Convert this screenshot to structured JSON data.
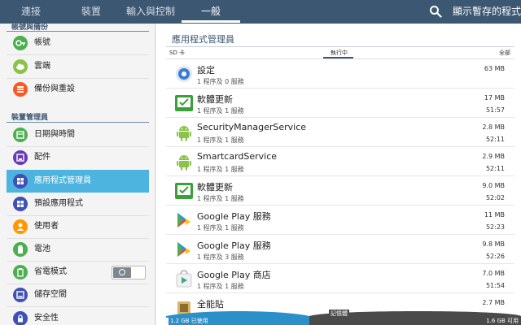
{
  "tabs": [
    {
      "label": "連接"
    },
    {
      "label": "裝置"
    },
    {
      "label": "輸入與控制"
    },
    {
      "label": "一般"
    }
  ],
  "topbar": {
    "action_label": "顯示暫存的程式"
  },
  "sidebar": {
    "section_top": "帳號與備份",
    "items_top": [
      {
        "label": "帳號",
        "icon": "account-icon",
        "color": "#4caf50"
      },
      {
        "label": "雲端",
        "icon": "cloud-icon",
        "color": "#8bc34a"
      },
      {
        "label": "備份與重設",
        "icon": "backup-icon",
        "color": "#ff5722"
      }
    ],
    "section_device": "裝置管理員",
    "items_device": [
      {
        "label": "日期與時間",
        "icon": "calendar-icon",
        "color": "#4caf50"
      },
      {
        "label": "配件",
        "icon": "accessory-icon",
        "color": "#673ab7"
      },
      {
        "label": "應用程式管理員",
        "icon": "apps-icon",
        "color": "#3f51b5",
        "active": true
      },
      {
        "label": "預設應用程式",
        "icon": "default-apps-icon",
        "color": "#3f51b5"
      },
      {
        "label": "使用者",
        "icon": "users-icon",
        "color": "#ff9800"
      },
      {
        "label": "電池",
        "icon": "battery-icon",
        "color": "#4caf50"
      },
      {
        "label": "省電模式",
        "icon": "power-saving-icon",
        "color": "#4caf50"
      },
      {
        "label": "儲存空間",
        "icon": "storage-icon",
        "color": "#3f51b5"
      },
      {
        "label": "安全性",
        "icon": "security-icon",
        "color": "#3f51b5"
      }
    ]
  },
  "main": {
    "title": "應用程式管理員",
    "subtabs": [
      "SD 卡",
      "執行中",
      "全部"
    ],
    "apps": [
      {
        "name": "設定",
        "sub": "1 程序及 0 服務",
        "size": "63 MB",
        "time": "",
        "icon": "settings-icon"
      },
      {
        "name": "軟體更新",
        "sub": "1 程序及 1 服務",
        "size": "17 MB",
        "time": "51:57",
        "icon": "software-update-icon"
      },
      {
        "name": "SecurityManagerService",
        "sub": "1 程序及 1 服務",
        "size": "2.8 MB",
        "time": "52:11",
        "icon": "android-icon"
      },
      {
        "name": "SmartcardService",
        "sub": "1 程序及 1 服務",
        "size": "2.9 MB",
        "time": "52:11",
        "icon": "android-icon"
      },
      {
        "name": "軟體更新",
        "sub": "1 程序及 1 服務",
        "size": "9.0 MB",
        "time": "52:02",
        "icon": "software-update-icon"
      },
      {
        "name": "Google Play 服務",
        "sub": "1 程序及 1 服務",
        "size": "11 MB",
        "time": "52:23",
        "icon": "google-play-services-icon"
      },
      {
        "name": "Google Play 服務",
        "sub": "1 程序及 3 服務",
        "size": "9.8 MB",
        "time": "52:26",
        "icon": "google-play-services-icon"
      },
      {
        "name": "Google Play 商店",
        "sub": "1 程序及 1 服務",
        "size": "7.0 MB",
        "time": "51:54",
        "icon": "google-play-store-icon"
      },
      {
        "name": "全能貼",
        "sub": "",
        "size": "2.7 MB",
        "time": "",
        "icon": "app-icon"
      }
    ]
  },
  "storage": {
    "title": "記憶體",
    "used_label": "1.2 GB 已使用",
    "free_label": "1.6 GB 可用",
    "used_fraction": 0.4
  },
  "colors": {
    "topbar": "#3b5772",
    "accent": "#4db3df",
    "storage_used": "#2b8fc9"
  }
}
